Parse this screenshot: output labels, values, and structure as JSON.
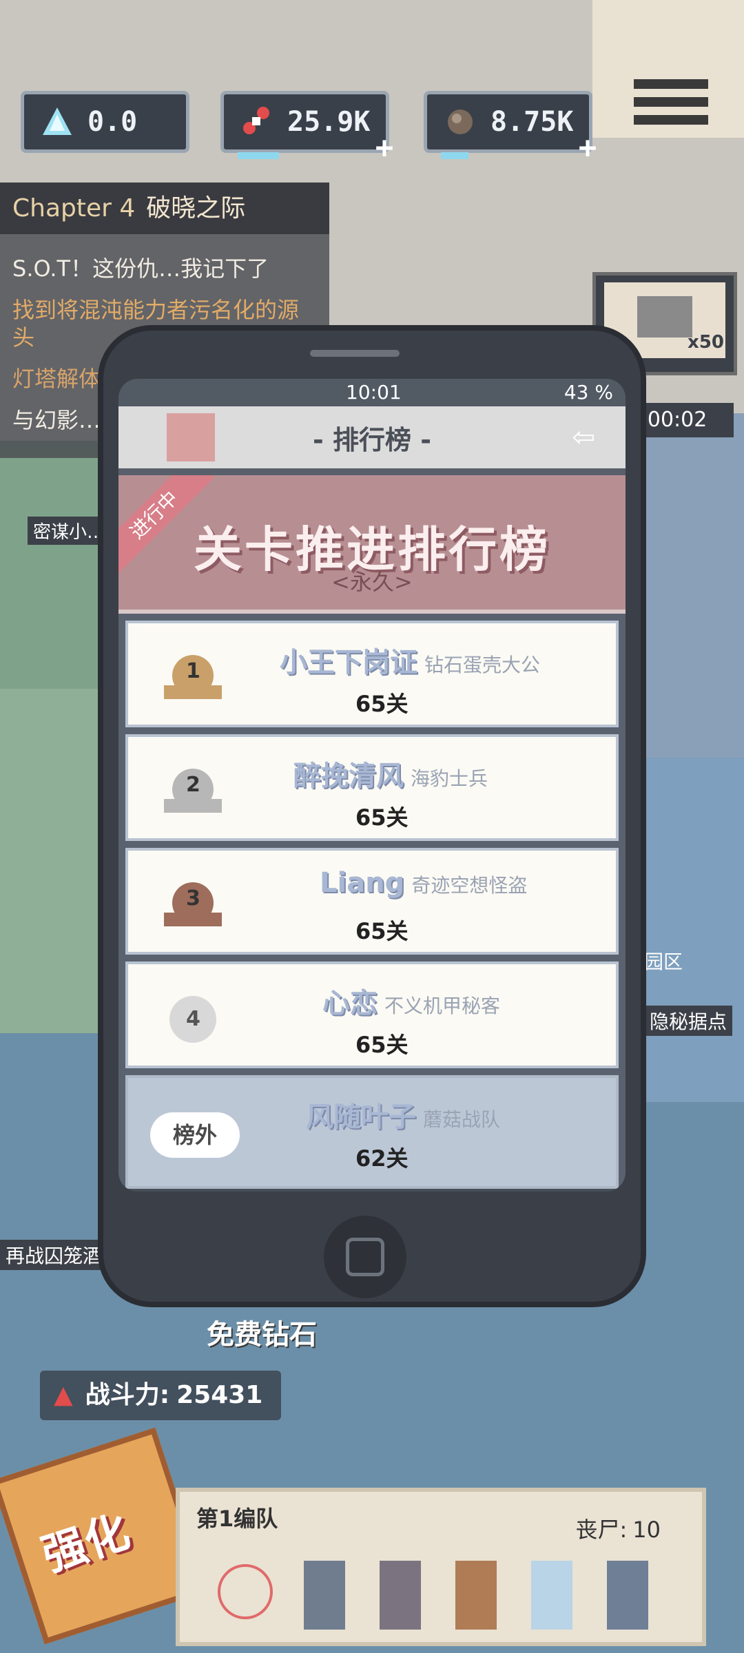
{
  "resources": {
    "gems": "0.0",
    "cash": "25.9K",
    "ore": "8.75K"
  },
  "quest": {
    "chapter": "Chapter 4",
    "chapter_name": "破晓之际",
    "line1": "S.O.T！这份仇…我记下了",
    "line2": "找到将混沌能力者污名化的源头",
    "line3": "灯塔解体了！",
    "line4": "与幻影…"
  },
  "map_labels": {
    "secret_agent": "密谋小…",
    "hidden_base": "隐秘据点",
    "district": "园区",
    "rematch": "再战囚笼酒",
    "free_gems": "免费钻石"
  },
  "chest": {
    "count": "x50",
    "timer": "00:02"
  },
  "phone": {
    "time": "10:01",
    "battery": "43 %",
    "header_title": "- 排行榜 -",
    "banner_title": "关卡推进排行榜",
    "banner_sub": "<永久>",
    "ribbon": "进行中"
  },
  "leaderboard": [
    {
      "rank": "1",
      "name": "小王下岗证",
      "title": "钻石蛋壳大公",
      "score": "65关",
      "medal_color": "#c9a06a"
    },
    {
      "rank": "2",
      "name": "醉挽清风",
      "title": "海豹士兵",
      "score": "65关",
      "medal_color": "#b7b7b7"
    },
    {
      "rank": "3",
      "name": "Liang",
      "title": "奇迹空想怪盗",
      "score": "65关",
      "medal_color": "#9e6d5c"
    },
    {
      "rank": "4",
      "name": "心恋",
      "title": "不义机甲秘客",
      "score": "65关",
      "medal_color": "#d8d8d8"
    }
  ],
  "self_entry": {
    "badge": "榜外",
    "name": "风随叶子",
    "title": "蘑菇战队",
    "score": "62关"
  },
  "power": {
    "label": "战斗力:",
    "value": "25431"
  },
  "team": {
    "name": "第1编队",
    "corpse_label": "丧尸:",
    "corpse_count": "10"
  },
  "upgrade_label": "强化"
}
